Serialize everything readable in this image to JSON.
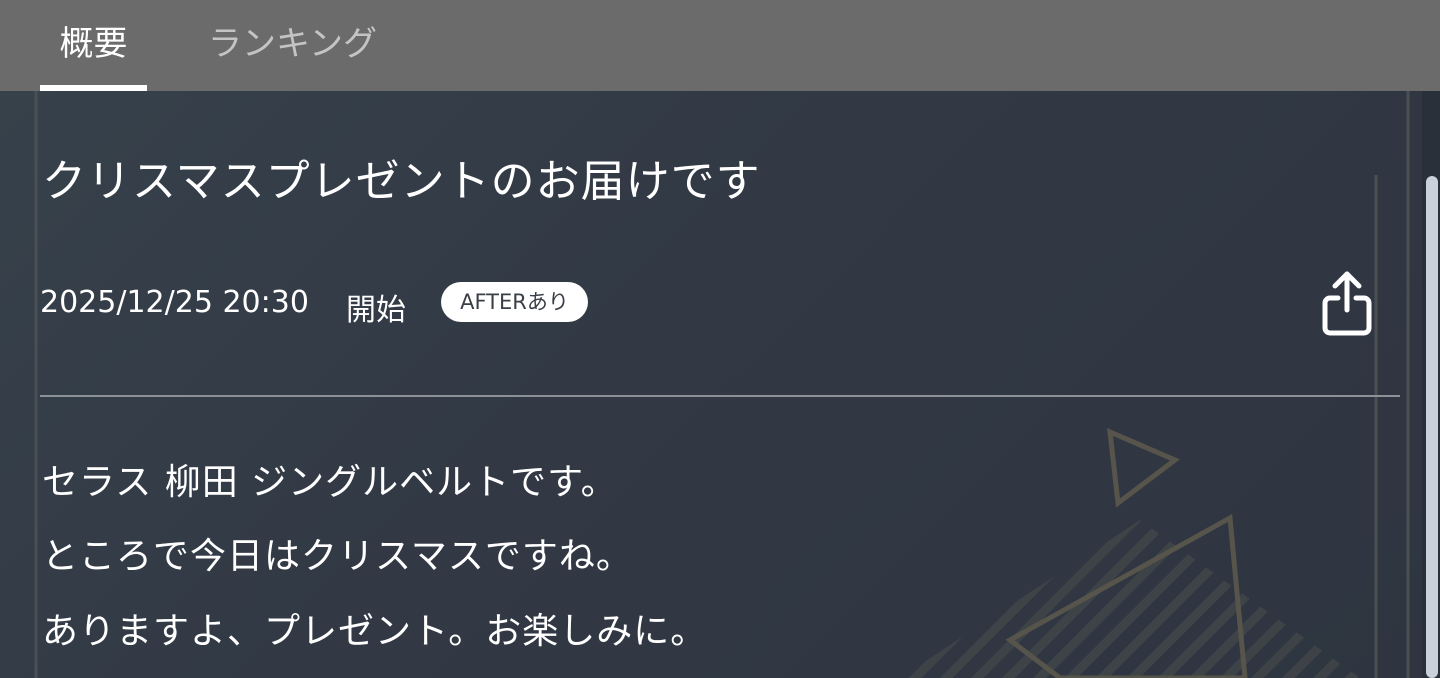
{
  "tabs": [
    {
      "label": "概要",
      "active": true
    },
    {
      "label": "ランキング",
      "active": false
    }
  ],
  "event": {
    "title": "クリスマスプレゼントのお届けです",
    "datetime": "2025/12/25 20:30",
    "start_label": "開始",
    "badge": "AFTERあり"
  },
  "description": [
    "セラス 柳田 ジングルベルトです。",
    "ところで今日はクリスマスですね。",
    "ありますよ、プレゼント。お楽しみに。"
  ],
  "icons": {
    "share": "share-icon"
  },
  "colors": {
    "tab_bar": "#6b6b6b",
    "background": "#323945",
    "active_tab": "#ffffff",
    "inactive_tab": "#c4c4c4",
    "badge_bg": "#ffffff",
    "badge_text": "#3a3f47",
    "scroll_thumb": "#c9d2da"
  }
}
